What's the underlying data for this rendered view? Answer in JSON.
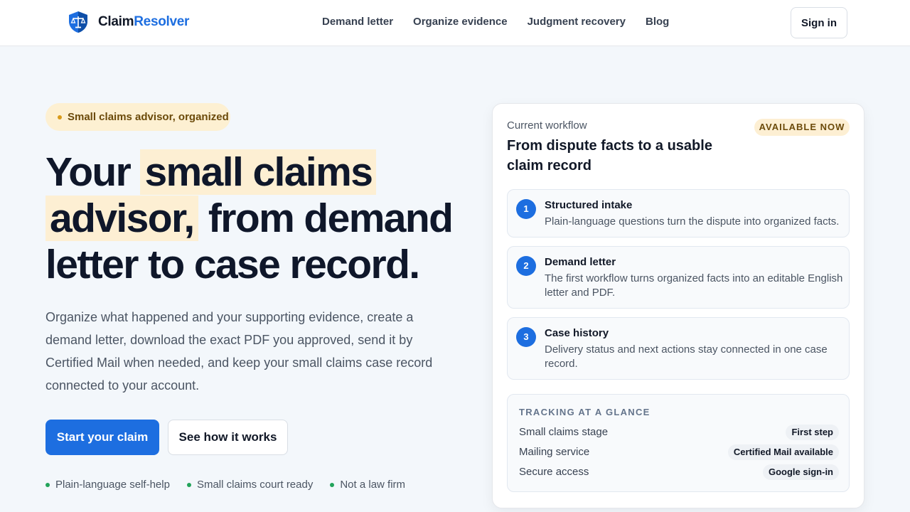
{
  "brand": {
    "name_part1": "Claim",
    "name_part2": "Resolver"
  },
  "nav": {
    "items": [
      {
        "label": "Demand letter"
      },
      {
        "label": "Organize evidence"
      },
      {
        "label": "Judgment recovery"
      },
      {
        "label": "Blog"
      }
    ],
    "signin_label": "Sign in"
  },
  "hero": {
    "pill": "Small claims advisor, organized",
    "headline_part1": "Your ",
    "headline_hl1": "small claims",
    "headline_hl2": "advisor,",
    "headline_part2": " from demand letter to case record.",
    "description": "Organize what happened and your supporting evidence, create a demand letter, download the exact PDF you approved, send it by Certified Mail when needed, and keep your small claims case record connected to your account.",
    "primary_cta": "Start your claim",
    "secondary_cta": "See how it works",
    "checks": [
      {
        "label": "Plain-language self-help"
      },
      {
        "label": "Small claims court ready"
      },
      {
        "label": "Not a law firm"
      }
    ]
  },
  "card": {
    "kicker": "Current workflow",
    "title": "From dispute facts to a usable claim record",
    "badge": "AVAILABLE NOW",
    "steps": [
      {
        "num": "1",
        "title": "Structured intake",
        "desc": "Plain-language questions turn the dispute into organized facts."
      },
      {
        "num": "2",
        "title": "Demand letter",
        "desc": "The first workflow turns organized facts into an editable English letter and PDF."
      },
      {
        "num": "3",
        "title": "Case history",
        "desc": "Delivery status and next actions stay connected in one case record."
      }
    ],
    "tracking": {
      "heading": "TRACKING AT A GLANCE",
      "rows": [
        {
          "key": "Small claims stage",
          "value": "First step"
        },
        {
          "key": "Mailing service",
          "value": "Certified Mail available"
        },
        {
          "key": "Secure access",
          "value": "Google sign-in"
        }
      ]
    }
  },
  "colors": {
    "accent": "#1d6ee0",
    "highlight": "#fdefd3",
    "check_dot": "#22a35a",
    "pill_dot": "#d99a1a"
  },
  "icons": {
    "logo": "shield-scales-icon"
  }
}
